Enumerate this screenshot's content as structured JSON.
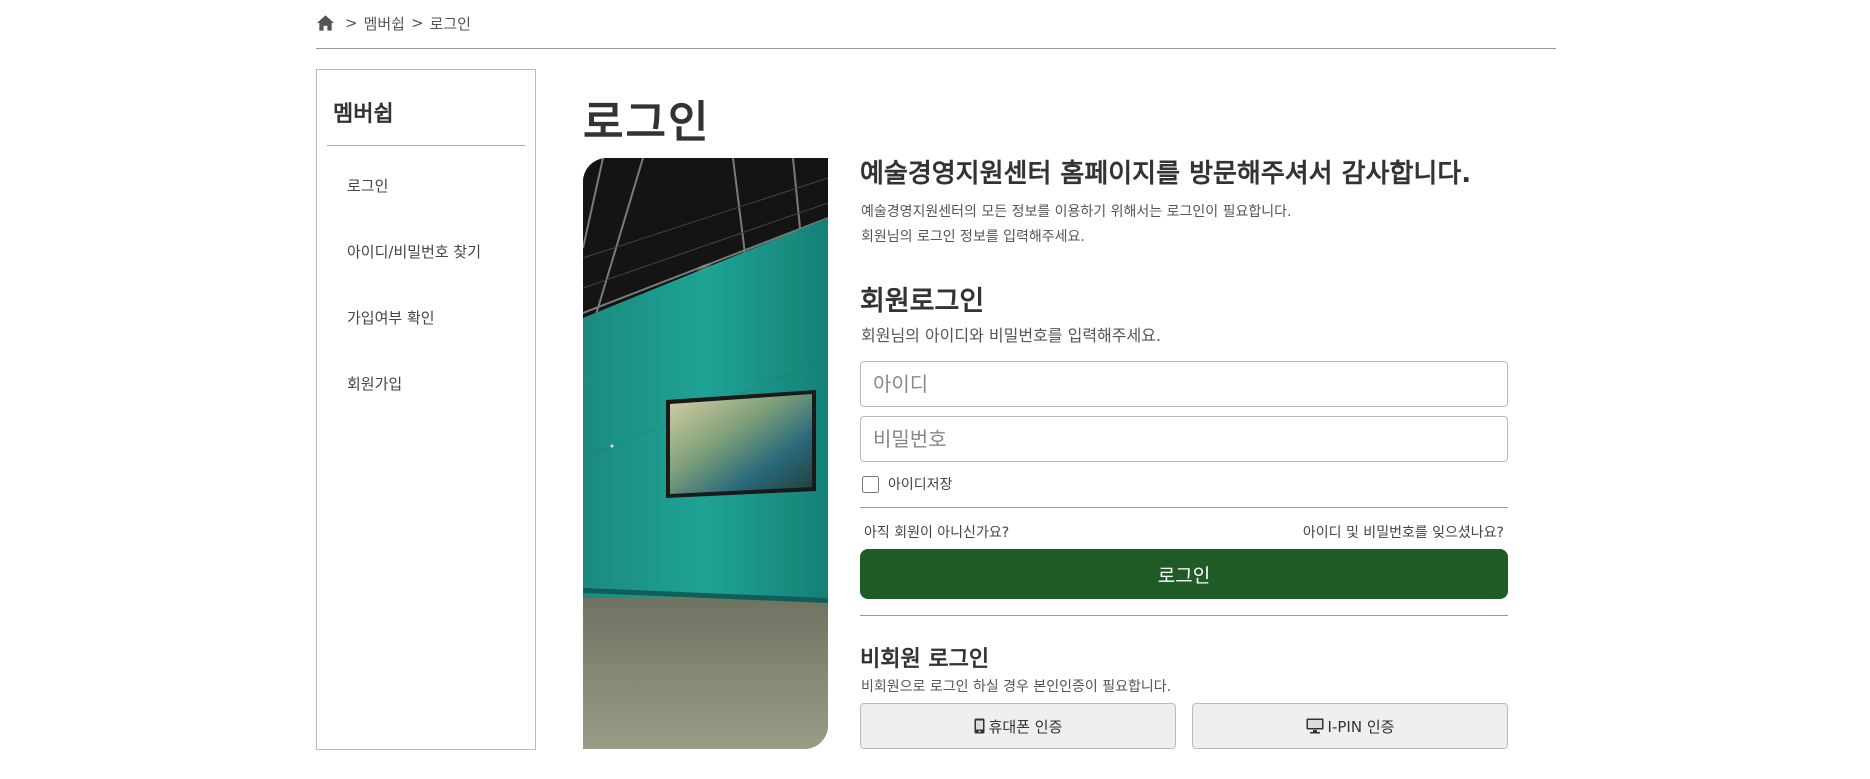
{
  "breadcrumb": {
    "sep": ">",
    "items": [
      "멤버쉽",
      "로그인"
    ]
  },
  "sidebar": {
    "title": "멤버쉽",
    "items": [
      {
        "label": "로그인"
      },
      {
        "label": "아이디/비밀번호 찾기"
      },
      {
        "label": "가입여부 확인"
      },
      {
        "label": "회원가입"
      }
    ]
  },
  "page": {
    "title": "로그인"
  },
  "intro": {
    "heading": "예술경영지원센터 홈페이지를 방문해주셔서 감사합니다.",
    "line1": "예술경영지원센터의 모든 정보를 이용하기 위해서는 로그인이 필요합니다.",
    "line2": "회원님의 로그인 정보를 입력해주세요."
  },
  "member_login": {
    "title": "회원로그인",
    "desc": "회원님의 아이디와 비밀번호를 입력해주세요.",
    "id_placeholder": "아이디",
    "pw_placeholder": "비밀번호",
    "save_id_label": "아이디저장",
    "save_id_checked": false,
    "not_member_link": "아직 회원이 아니신가요?",
    "forgot_link": "아이디 및 비밀번호를 잊으셨나요?",
    "login_button": "로그인"
  },
  "guest_login": {
    "title": "비회원 로그인",
    "desc": "비회원으로 로그인 하실 경우 본인인증이 필요합니다.",
    "phone_button": "휴대폰 인증",
    "ipin_button": "I-PIN 인증"
  },
  "colors": {
    "accent": "#1e5b27",
    "border": "#bbbbbb"
  }
}
